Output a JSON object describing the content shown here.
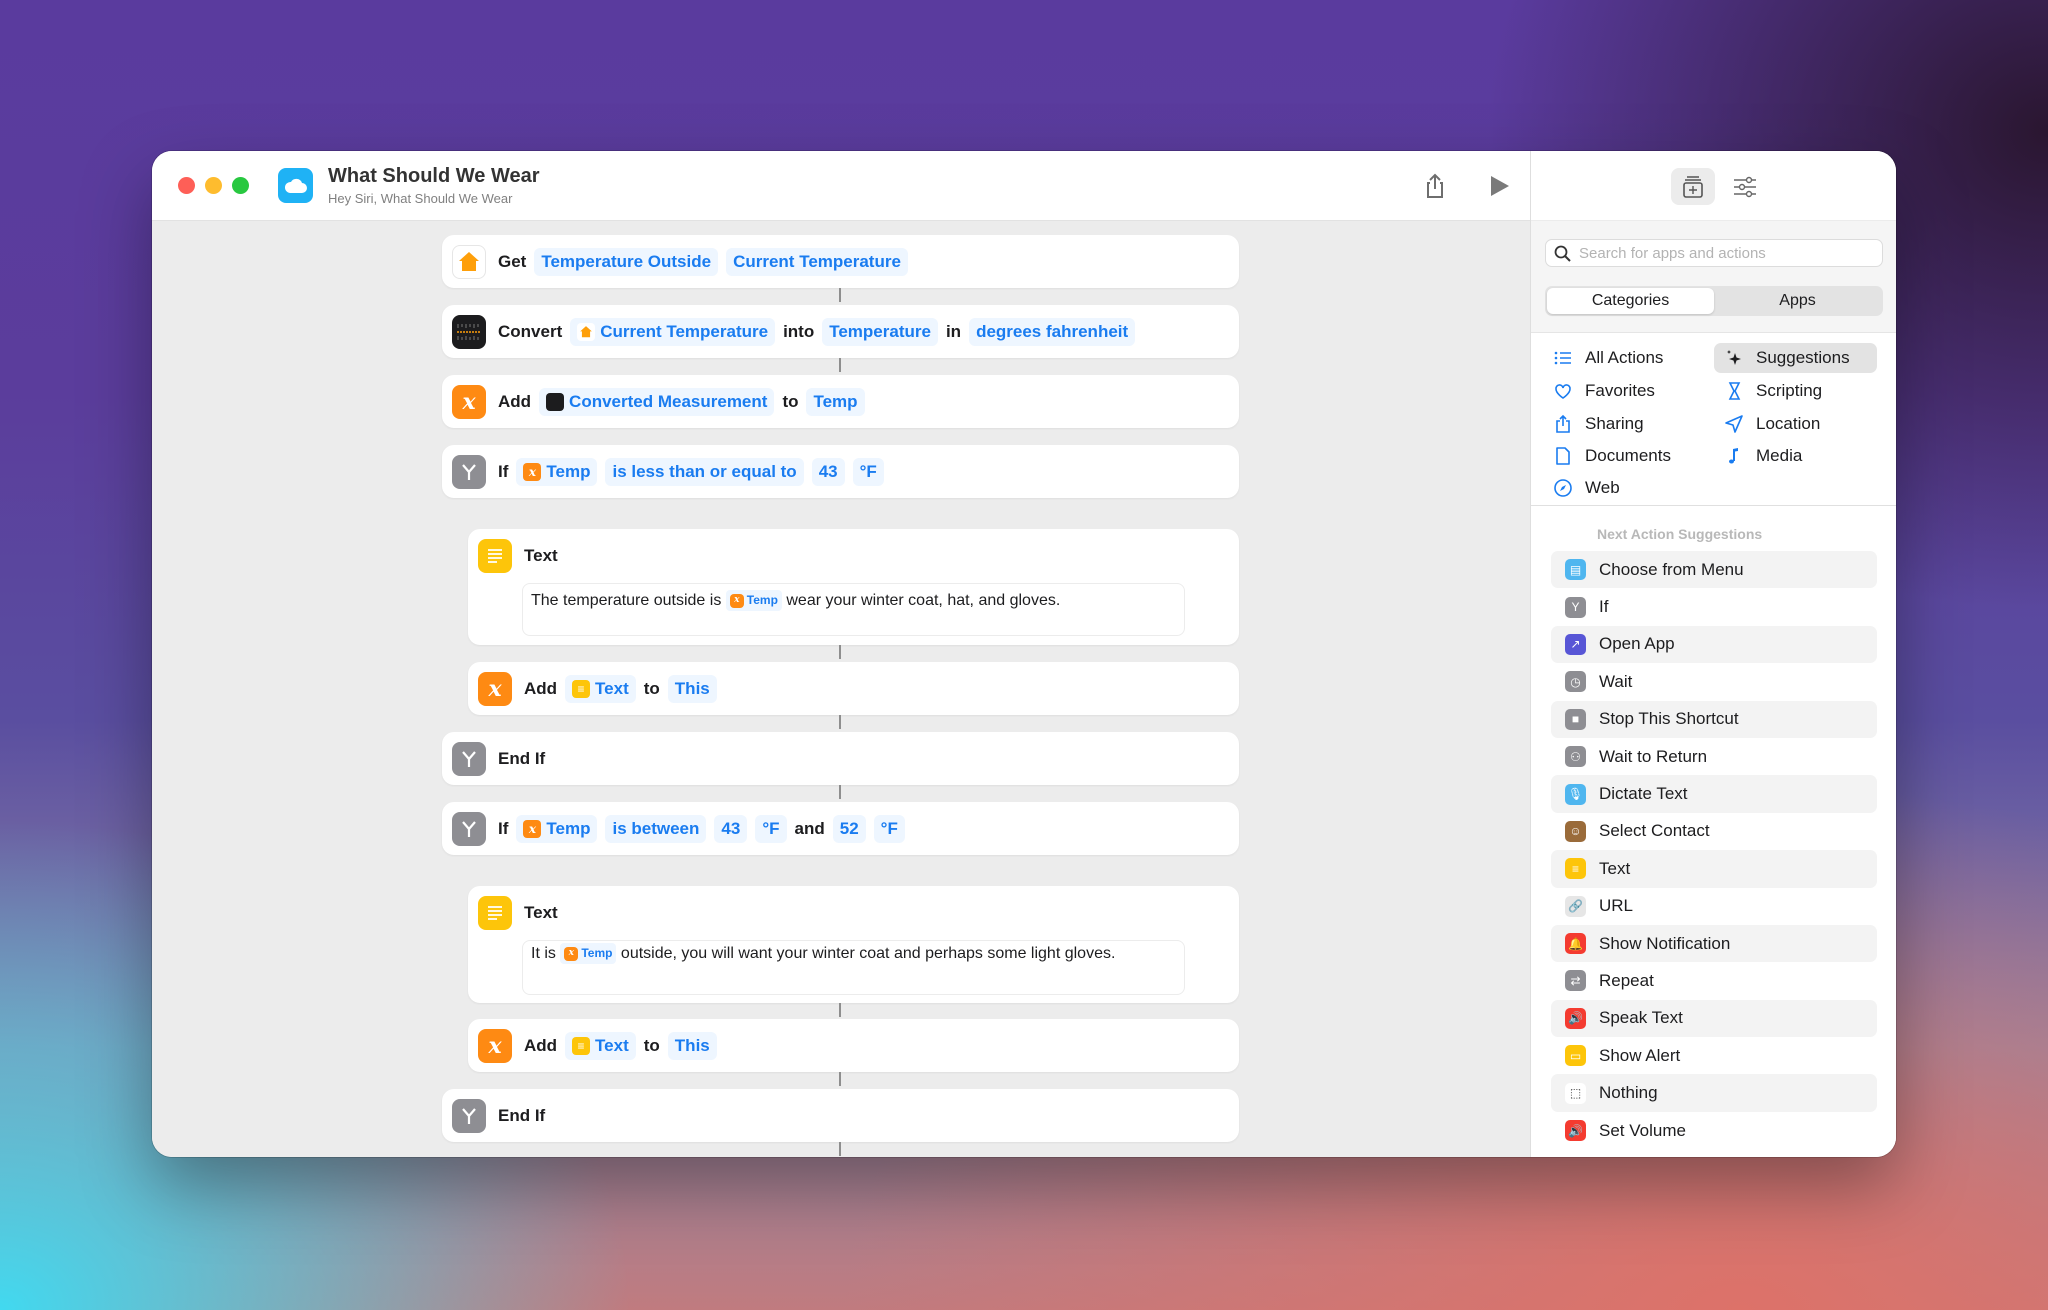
{
  "window": {
    "title": "What Should We Wear",
    "subtitle": "Hey Siri, What Should We Wear"
  },
  "colors": {
    "accent_blue": "#1a7cf0",
    "variable_orange": "#fe8a13",
    "scripting_gray": "#8e8e93",
    "text_yellow": "#fdc50a",
    "app_icon_blue": "#1fb2f5"
  },
  "actions": [
    {
      "verb": "Get",
      "icon": "home-icon",
      "params": [
        "Temperature Outside",
        "Current Temperature"
      ]
    },
    {
      "verb": "Convert",
      "icon": "measure-icon",
      "param1": "Current Temperature",
      "word1": "into",
      "param2": "Temperature",
      "word2": "in",
      "param3": "degrees fahrenheit"
    },
    {
      "verb": "Add",
      "icon": "variable-icon",
      "param1": "Converted Measurement",
      "word1": "to",
      "param2": "Temp"
    },
    {
      "verb": "If",
      "icon": "if-icon",
      "var": "Temp",
      "condition": "is less than or equal to",
      "value": "43",
      "unit": "°F"
    },
    {
      "verb": "Text",
      "icon": "text-icon",
      "before": "The temperature outside is",
      "var": "Temp",
      "after": "wear your winter coat, hat, and gloves."
    },
    {
      "verb": "Add",
      "icon": "variable-icon",
      "param1": "Text",
      "word1": "to",
      "param2": "This"
    },
    {
      "verb": "End If",
      "icon": "if-icon"
    },
    {
      "verb": "If",
      "icon": "if-icon",
      "var": "Temp",
      "condition": "is between",
      "value1": "43",
      "unit1": "°F",
      "word": "and",
      "value2": "52",
      "unit2": "°F"
    },
    {
      "verb": "Text",
      "icon": "text-icon",
      "before": "It is",
      "var": "Temp",
      "after": "outside, you will want your winter coat and perhaps some light gloves."
    },
    {
      "verb": "Add",
      "icon": "variable-icon",
      "param1": "Text",
      "word1": "to",
      "param2": "This"
    },
    {
      "verb": "End If",
      "icon": "if-icon"
    }
  ],
  "sidebar": {
    "search_placeholder": "Search for apps and actions",
    "segments": [
      "Categories",
      "Apps"
    ],
    "categories": [
      {
        "label": "All Actions",
        "icon": "list-icon"
      },
      {
        "label": "Suggestions",
        "icon": "sparkles-icon",
        "selected": true
      },
      {
        "label": "Favorites",
        "icon": "heart-icon"
      },
      {
        "label": "Scripting",
        "icon": "scroll-icon"
      },
      {
        "label": "Sharing",
        "icon": "share-icon"
      },
      {
        "label": "Location",
        "icon": "location-arrow-icon"
      },
      {
        "label": "Documents",
        "icon": "document-icon"
      },
      {
        "label": "Media",
        "icon": "music-note-icon"
      },
      {
        "label": "Web",
        "icon": "compass-icon"
      }
    ],
    "suggestions_header": "Next Action Suggestions",
    "suggestions": [
      {
        "label": "Choose from Menu",
        "icon": "menu-icon",
        "color": "#4fb6ef"
      },
      {
        "label": "If",
        "icon": "if-icon",
        "color": "#8e8e93"
      },
      {
        "label": "Open App",
        "icon": "open-app-icon",
        "color": "#5856d6"
      },
      {
        "label": "Wait",
        "icon": "clock-icon",
        "color": "#8e8e93"
      },
      {
        "label": "Stop This Shortcut",
        "icon": "stop-icon",
        "color": "#8e8e93"
      },
      {
        "label": "Wait to Return",
        "icon": "wait-return-icon",
        "color": "#8e8e93"
      },
      {
        "label": "Dictate Text",
        "icon": "microphone-icon",
        "color": "#4fb6ef"
      },
      {
        "label": "Select Contact",
        "icon": "contacts-icon",
        "color": "#9a6b3a"
      },
      {
        "label": "Text",
        "icon": "text-icon",
        "color": "#fdc50a"
      },
      {
        "label": "URL",
        "icon": "link-icon",
        "color": "#e6e6e6"
      },
      {
        "label": "Show Notification",
        "icon": "bell-icon",
        "color": "#f43b30"
      },
      {
        "label": "Repeat",
        "icon": "repeat-icon",
        "color": "#8e8e93"
      },
      {
        "label": "Speak Text",
        "icon": "speaker-icon",
        "color": "#f43b30"
      },
      {
        "label": "Show Alert",
        "icon": "alert-window-icon",
        "color": "#fdc50a"
      },
      {
        "label": "Nothing",
        "icon": "dashed-square-icon",
        "color": "#ffffff"
      },
      {
        "label": "Set Volume",
        "icon": "speaker-icon",
        "color": "#f43b30"
      }
    ]
  }
}
